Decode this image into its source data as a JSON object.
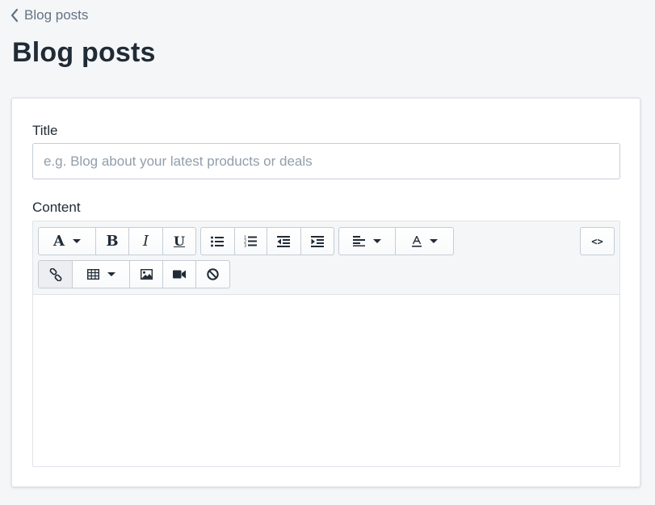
{
  "breadcrumb": {
    "label": "Blog posts",
    "icon": "chevron-left-icon"
  },
  "page": {
    "title": "Blog posts"
  },
  "form": {
    "title_label": "Title",
    "title_placeholder": "e.g. Blog about your latest products or deals",
    "title_value": "",
    "content_label": "Content",
    "content_value": ""
  },
  "toolbar": {
    "font_glyph": "A",
    "bold_glyph": "B",
    "italic_glyph": "I",
    "underline_glyph": "U",
    "source_glyph": "<>",
    "icons": {
      "font": "font-icon",
      "bold": "bold-icon",
      "italic": "italic-icon",
      "underline": "underline-icon",
      "bullet_list": "bullet-list-icon",
      "numbered_list": "numbered-list-icon",
      "outdent": "outdent-icon",
      "indent": "indent-icon",
      "align": "align-left-icon",
      "text_color": "text-color-icon",
      "source": "code-icon",
      "link": "link-icon",
      "table": "table-icon",
      "image": "image-icon",
      "video": "video-icon",
      "clear": "clear-formatting-icon"
    }
  },
  "colors": {
    "page_bg": "#f4f6f8",
    "card_bg": "#ffffff",
    "text": "#212b36",
    "muted": "#637381",
    "placeholder": "#919eab",
    "border": "#c4cdd5"
  }
}
